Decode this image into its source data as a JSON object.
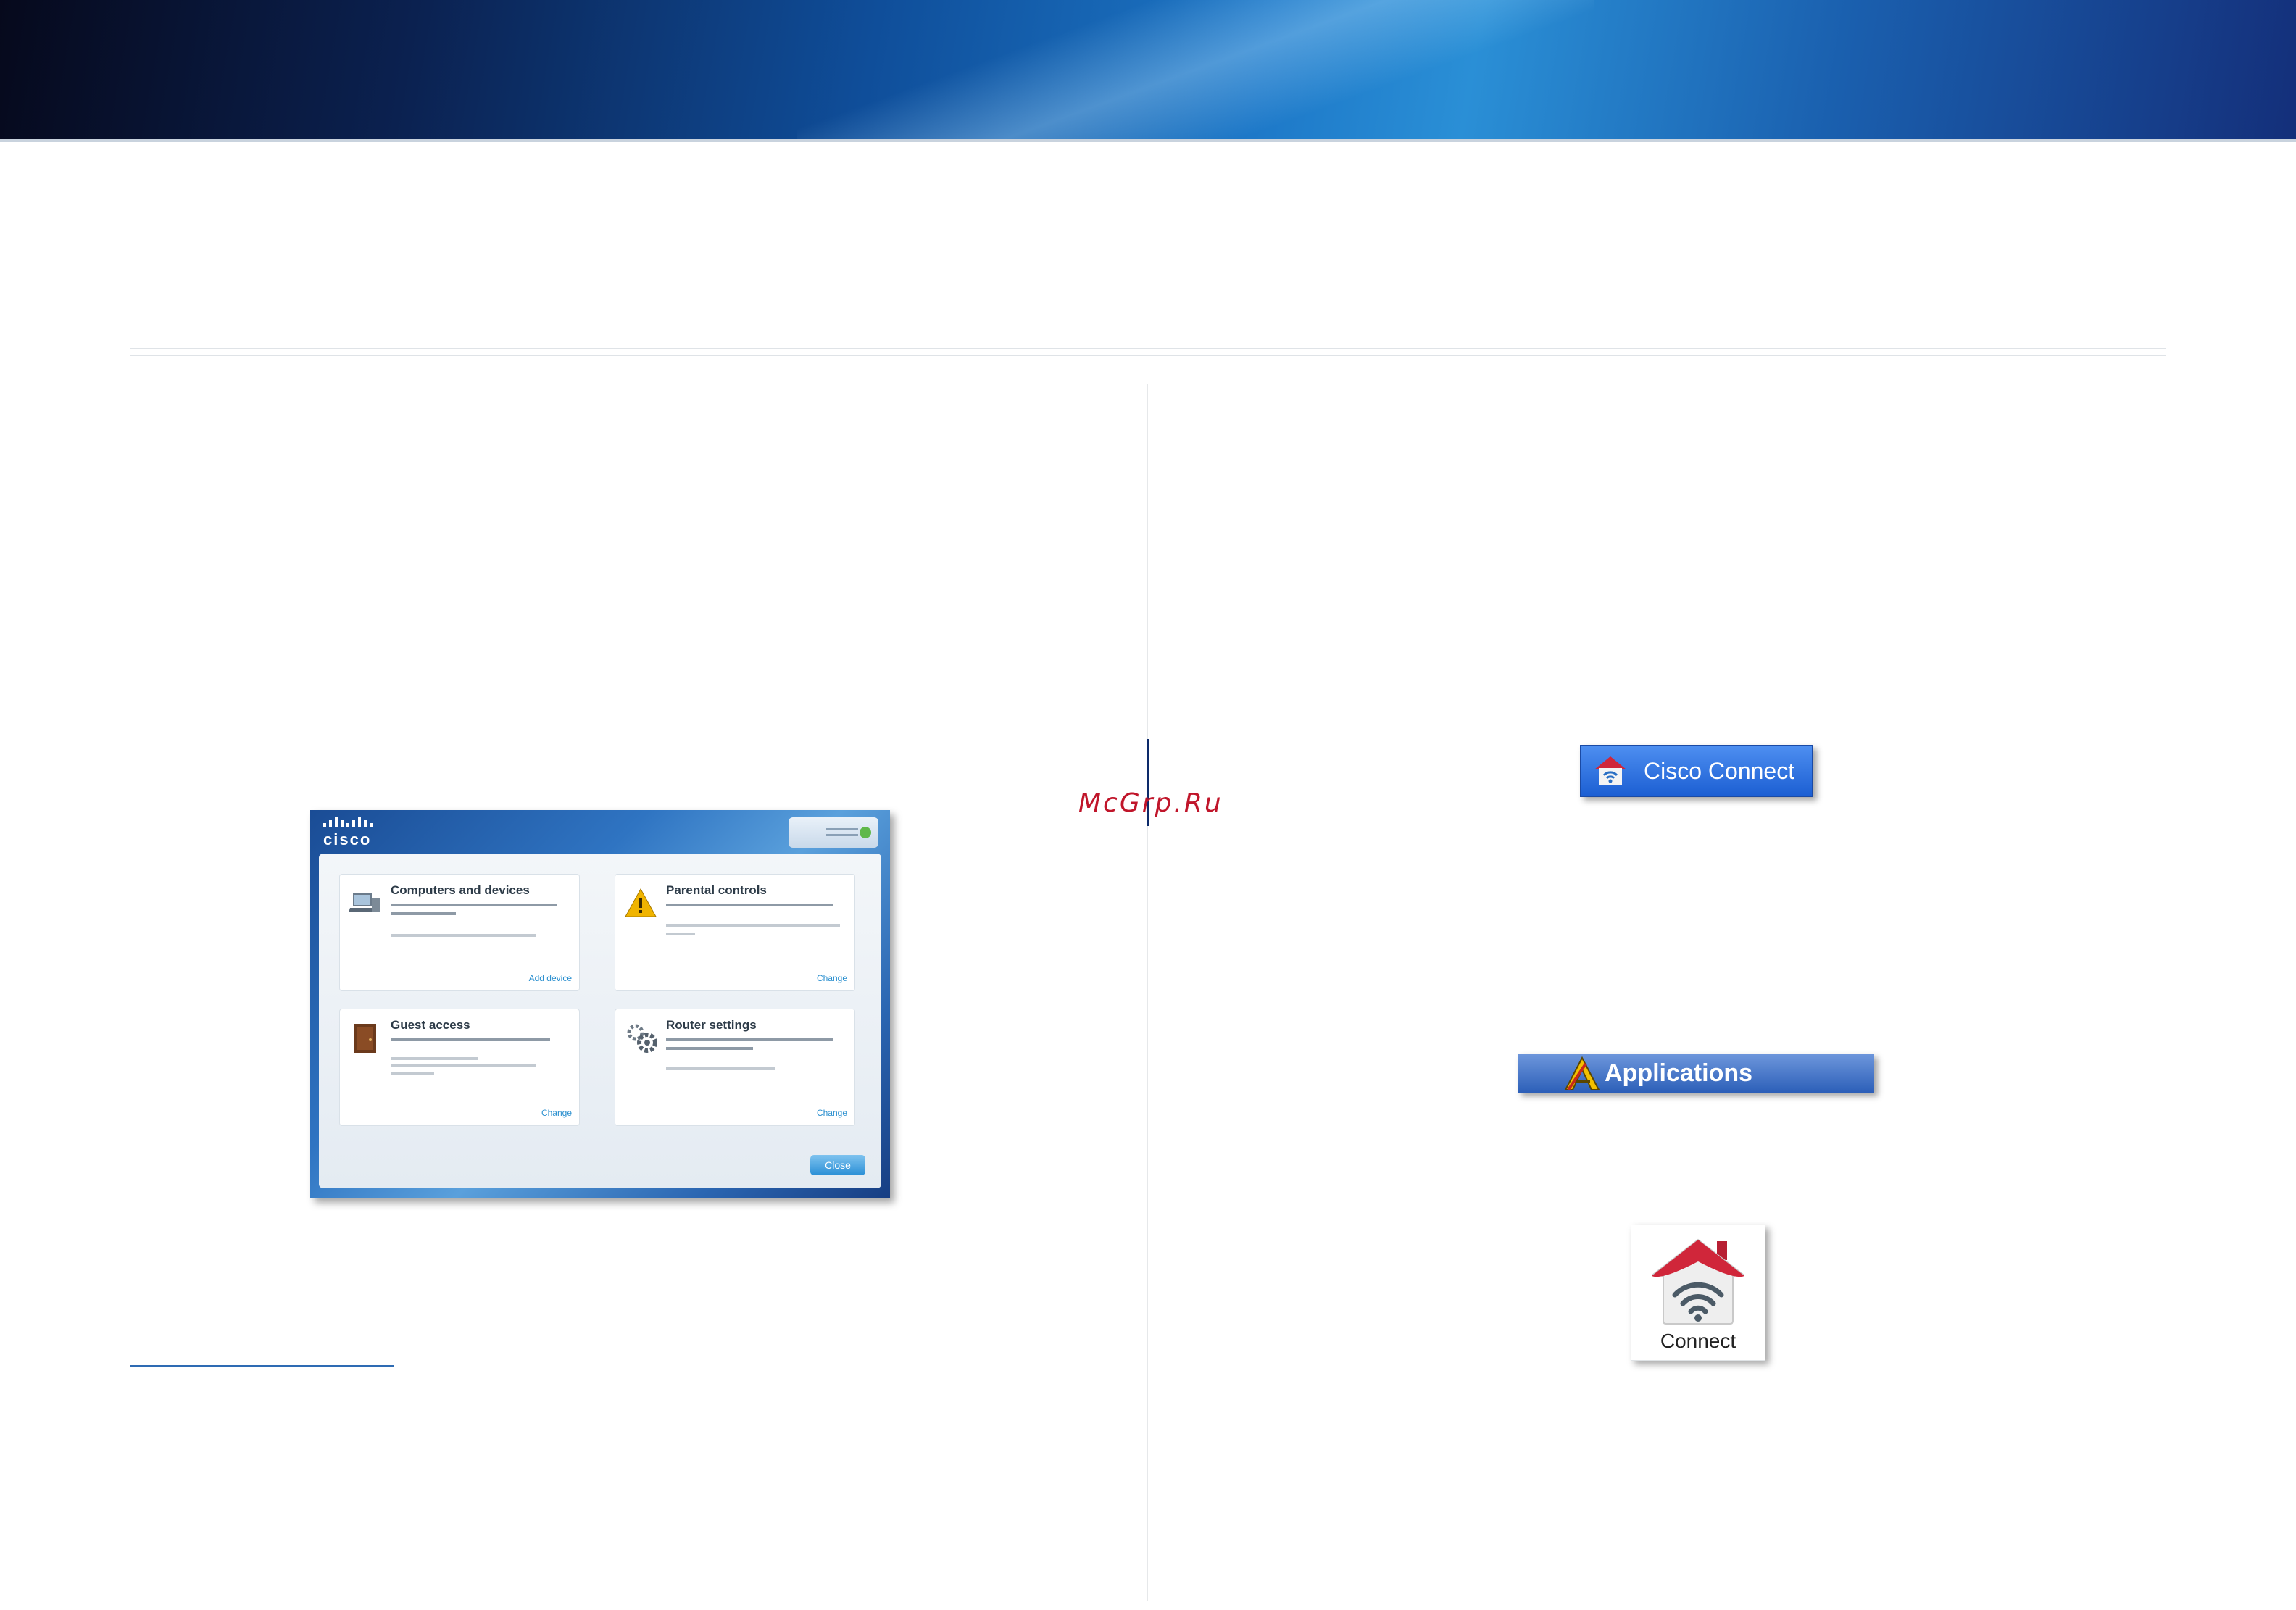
{
  "watermark": "McGrp.Ru",
  "dashboard_screenshot": {
    "logo": "cisco",
    "cards": [
      {
        "title": "Computers and devices",
        "link": "Add device"
      },
      {
        "title": "Parental controls",
        "link": "Change"
      },
      {
        "title": "Guest access",
        "link": "Change"
      },
      {
        "title": "Router settings",
        "link": "Change"
      }
    ],
    "close_label": "Close"
  },
  "taskbar_button": {
    "label": "Cisco Connect",
    "icon": "cisco-connect-house-icon"
  },
  "applications_bar": {
    "label": "Applications",
    "icon": "applications-icon"
  },
  "connect_app": {
    "label": "Connect",
    "icon": "connect-house-wifi-icon"
  },
  "colors": {
    "accent_blue": "#1c5fd3",
    "house_red": "#d0263a",
    "watermark_red": "#c0152a"
  }
}
